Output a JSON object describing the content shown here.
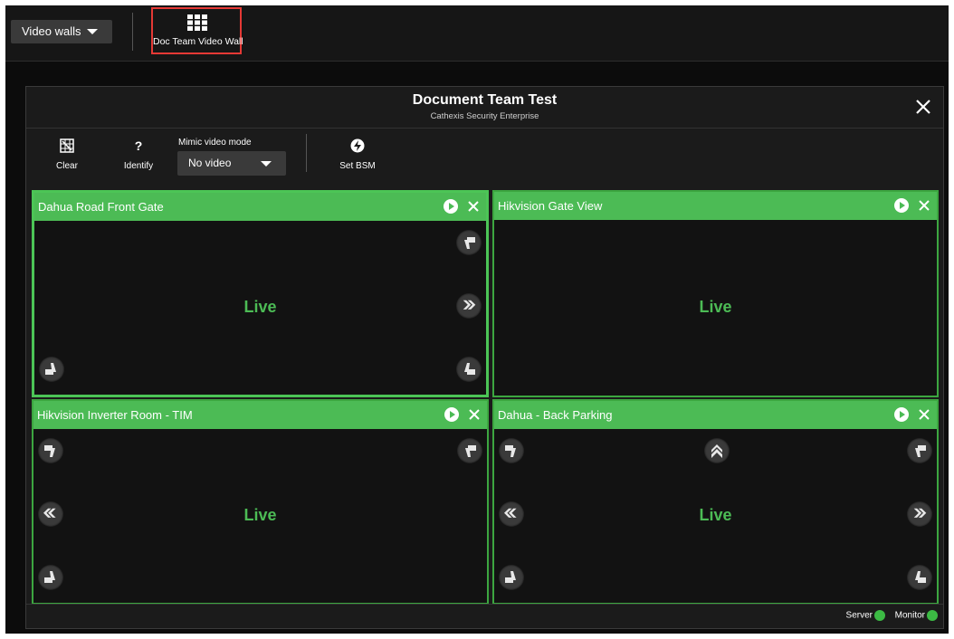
{
  "topbar": {
    "video_walls_label": "Video walls",
    "selected_wall": "Doc Team Video Wall"
  },
  "dialog": {
    "title": "Document Team Test",
    "subtitle": "Cathexis Security Enterprise"
  },
  "toolbar": {
    "clear_label": "Clear",
    "identify_label": "Identify",
    "identify_icon": "?",
    "mimic_label": "Mimic video mode",
    "mimic_value": "No video",
    "set_bsm_label": "Set BSM"
  },
  "tiles": [
    {
      "name": "Dahua Road Front Gate",
      "status": "Live"
    },
    {
      "name": "Hikvision Gate View",
      "status": "Live"
    },
    {
      "name": "Hikvision Inverter Room - TIM",
      "status": "Live"
    },
    {
      "name": "Dahua - Back Parking",
      "status": "Live"
    }
  ],
  "status": {
    "server_label": "Server",
    "monitor_label": "Monitor"
  },
  "colors": {
    "accent": "#4cbb55",
    "selection": "#e53935",
    "status_ok": "#3cba44"
  }
}
